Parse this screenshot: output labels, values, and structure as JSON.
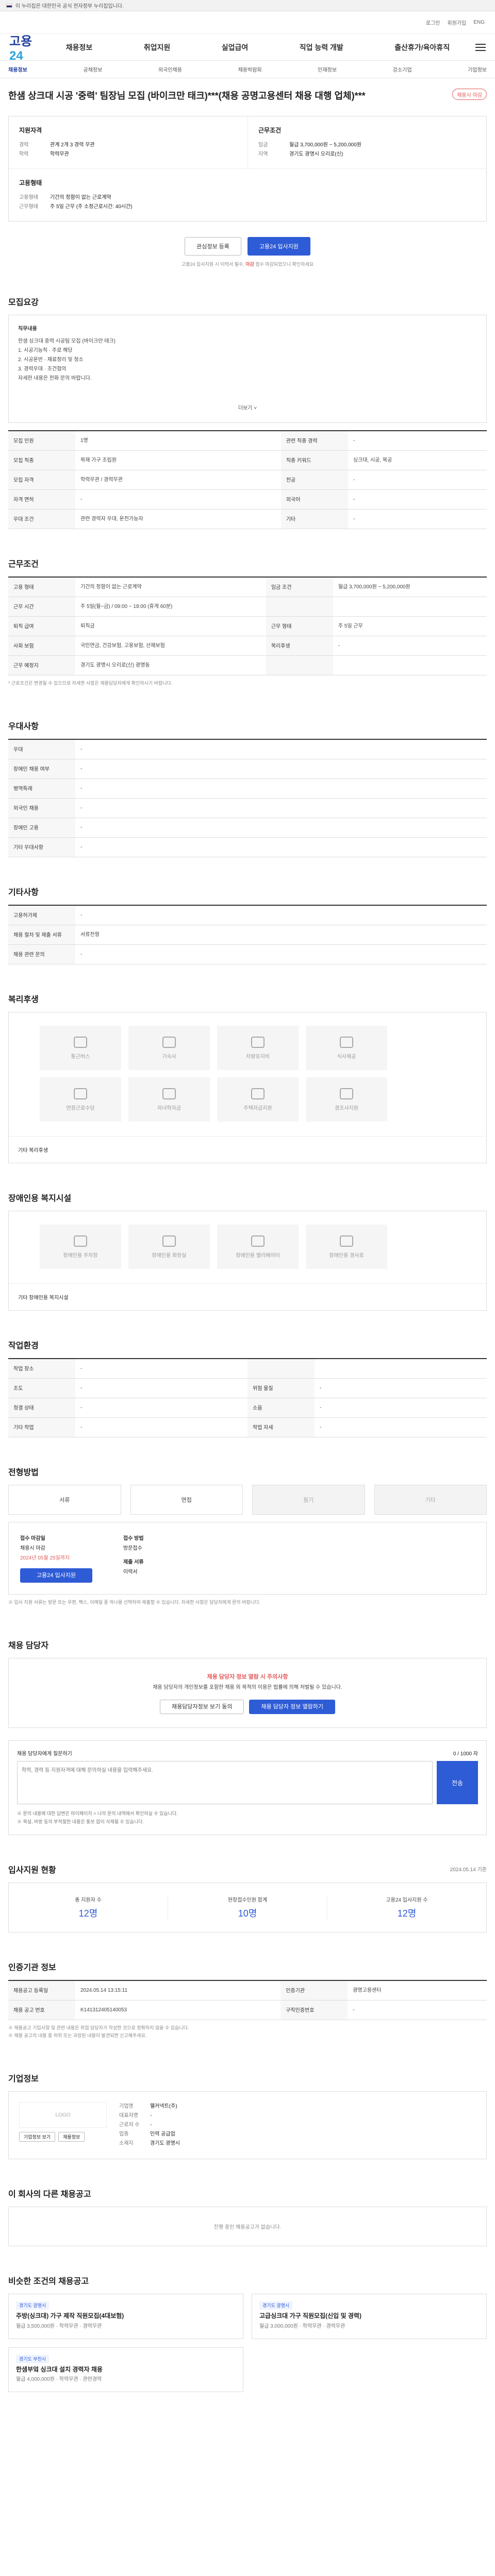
{
  "gov": {
    "text": "이 누리집은 대한민국 공식 전자정부 누리집입니다."
  },
  "util": [
    "로그인",
    "회원가입",
    "ENG"
  ],
  "brand": {
    "logo_a": "고용",
    "logo_b": "24"
  },
  "gnb": [
    "채용정보",
    "취업지원",
    "실업급여",
    "직업 능력 개발",
    "출산휴가/육아휴직"
  ],
  "subnav": {
    "items": [
      "채용정보",
      "공채정보",
      "외국인채용",
      "채용박람회",
      "인재정보",
      "강소기업",
      "기업정보"
    ],
    "active": 0
  },
  "job": {
    "title": "한샘 상크대 시공 '중력' 팀장님 모집 (바이크만 태크)***(채용 공명고용센터 채용 대행 업체)***",
    "badge": "채용시 마감"
  },
  "summary": {
    "qual_title": "지원자격",
    "qual": [
      [
        "경력",
        "관계 2개 3 경력 무관"
      ],
      [
        "학력",
        "학력무관"
      ]
    ],
    "cond_title": "근무조건",
    "cond": [
      [
        "임금",
        "월급 3,700,000원 ~ 5,200,000원"
      ],
      [
        "지역",
        "경기도 광명시 오리로(신)"
      ]
    ],
    "emp_title": "고용형태",
    "emp": [
      [
        "고용형태",
        "기간의 정함이 없는 근로계약"
      ],
      [
        "근무형태",
        "주 5일 근무 (주 소정근로시간: 40시간)"
      ]
    ]
  },
  "actions": {
    "scrap": "관심정보 등록",
    "apply": "고용24 입사지원",
    "note_a": "고용24 입사지원 시 이력서 필수, ",
    "note_red": "마감 ",
    "note_b": "접수 마감되었으니 확인하세요"
  },
  "sections": {
    "recruit": "모집요강",
    "work": "근무조건",
    "welfare": "복리후생",
    "convenience": "장애인용 복지시설",
    "screening": "우대사항",
    "other": "기타사항",
    "env": "작업환경",
    "method": "전형방법",
    "manager": "채용 담당자",
    "stats": "입사지원 현황",
    "info": "인증기관 정보",
    "company": "기업정보",
    "recommend": "이 회사의 다른 채용공고",
    "similar": "비슷한 조건의 채용공고"
  },
  "recruit": {
    "desc_label": "직무내용",
    "desc": "한샘 싱크대 중력 시공팀 모집 (바이크만 태크)\n1. 시공기능직 · 주로 해당\n2. 시공운반 · 재료정리 및 청소\n3. 경력우대 · 조건협의\n자세한 내용은 전화 문의 바랍니다.",
    "more": "더보기 ˅",
    "rows": [
      [
        "모집 인원",
        "1명",
        "관련 직종 경력",
        "-"
      ],
      [
        "모집 직종",
        "목재 가구 조립원",
        "직종 키워드",
        "싱크대, 시공, 목공"
      ],
      [
        "모집 자격",
        "학력무관 / 경력무관",
        "전공",
        "-"
      ],
      [
        "자격 면허",
        "-",
        "외국어",
        "-"
      ],
      [
        "우대 조건",
        "관련 경력자 우대, 운전가능자",
        "기타",
        "-"
      ]
    ]
  },
  "work": {
    "rows": [
      [
        "고용 형태",
        "기간의 정함이 없는 근로계약",
        "임금 조건",
        "월급 3,700,000원 ~ 5,200,000원"
      ],
      [
        "근무 시간",
        "주 5일(월~금) / 09:00 ~ 18:00 (휴게 60분)",
        "",
        ""
      ],
      [
        "퇴직 급여",
        "퇴직금",
        "근무 형태",
        "주 5일 근무"
      ],
      [
        "사회 보험",
        "국민연금, 건강보험, 고용보험, 산재보험",
        "복리후생",
        "-"
      ],
      [
        "근무 예정지",
        "경기도 광명시 오리로(신) 광명동",
        "",
        ""
      ]
    ],
    "foot": "* 근로조건은 변경될 수 있으므로 자세한 사항은 채용담당자에게 확인하시기 바랍니다."
  },
  "welfare_icons": [
    "통근버스",
    "기숙사",
    "차량유지비",
    "식사제공",
    "연장근로수당",
    "자녀학자금",
    "주택자금지원",
    "경조사지원"
  ],
  "welfare_other": "기타 복리후생",
  "convenience_icons": [
    "장애인용 주차장",
    "장애인용 화장실",
    "장애인용 엘리베이터",
    "장애인용 경사로"
  ],
  "convenience_other": "기타 장애인용 복지시설",
  "screening": {
    "rows": [
      [
        "우대",
        "-"
      ],
      [
        "장애인 채용 여부",
        "-"
      ],
      [
        "병역특례",
        "-"
      ],
      [
        "외국인 채용",
        "-"
      ],
      [
        "장애인 고용",
        "-"
      ],
      [
        "기타 우대사항",
        "-"
      ]
    ]
  },
  "other": {
    "rows": [
      [
        "고용허가제",
        "-"
      ],
      [
        "채용 절차 및 제출 서류",
        "서류전형"
      ],
      [
        "채용 관련 문의",
        "-"
      ]
    ]
  },
  "env": {
    "rows": [
      [
        "작업 장소",
        "-",
        "",
        ""
      ],
      [
        "조도",
        "-",
        "위험 물질",
        "-"
      ],
      [
        "청결 상태",
        "-",
        "소음",
        "-"
      ],
      [
        "기타 작업",
        "-",
        "작업 자세",
        "-"
      ]
    ]
  },
  "method": {
    "cards": [
      "서류",
      "면접",
      "필기",
      "기타"
    ],
    "apply_label": "접수 마감일",
    "apply_val": "채용시 마감",
    "apply_red": "2024년 05월 25일까지",
    "apply_btn": "고용24 입사지원",
    "way_label": "접수 방법",
    "way_val": "방문접수",
    "doc_label": "제출 서류",
    "doc_val": "이력서",
    "notes": "※ 입사 지원 서류는 방문 또는 우편, 팩스, 이메일 중 하나를 선택하여 제출할 수 있습니다. 자세한 사항은 담당자에게 문의 바랍니다."
  },
  "manager": {
    "warn_title": "채용 담당자 정보 열람 시 주의사항",
    "warn_text": "채용 담당자의 개인정보를 포함한 채용 외 목적의 이용은 법률에 의해 처벌될 수 있습니다.",
    "btn_a": "채용담당자정보 보기 동의",
    "btn_b": "채용 담당자 정보 열람하기",
    "inq_label": "채용 담당자에게 질문하기",
    "inq_count": "0 / 1000 자",
    "inq_placeholder": "학력, 경력 등 지원자격에 대해 문의하실 내용을 입력해주세요.",
    "inq_send": "전송",
    "inq_notes": "※ 문의 내용에 대한 답변은 마이페이지 > 나의 문의 내역에서 확인하실 수 있습니다.\n※ 욕설, 비방 등의 부적절한 내용은 통보 없이 삭제될 수 있습니다."
  },
  "stats": {
    "items": [
      [
        "총 지원자 수",
        "12명"
      ],
      [
        "현장접수인원 합계",
        "10명"
      ],
      [
        "고용24 입사지원 수",
        "12명"
      ]
    ],
    "date": "2024.05.14 기준"
  },
  "info": {
    "rows": [
      [
        "채용공고 등록일",
        "2024.05.14 13:15:11",
        "인증기관",
        "광명고용센터"
      ],
      [
        "채용 공고 번호",
        "K141312405140053",
        "구직인증번호",
        "-"
      ]
    ],
    "notes": "※ 채용공고 기입사항 및 관련 내용은 취업 담당자가 작성한 것으로 정확하지 않을 수 있습니다.\n※ 채용 공고의 내용 중 허위 또는 과장된 내용이 발견되면 신고해주세요."
  },
  "company": {
    "logo": "LOGO",
    "name_label": "기업명",
    "name": "웰커넥트(주)",
    "rep_label": "대표자명",
    "rep": "-",
    "emp_label": "근로자 수",
    "emp": "-",
    "industry_label": "업종",
    "industry": "인력 공급업",
    "addr_label": "소재지",
    "addr": "경기도 광명시",
    "btn_info": "기업정보 보기",
    "btn_jobs": "채용정보"
  },
  "recommend": {
    "empty": "진행 중인 채용공고가 없습니다."
  },
  "similar": {
    "items": [
      {
        "tag": "경기도 광명시",
        "title": "주방(싱크대) 가구 제작 직원모집(4대보험)",
        "meta": "월급 3,500,000원 · 학력무관 · 경력무관"
      },
      {
        "tag": "경기도 광명시",
        "title": "고급싱크대 가구 직원모집(신입 및 경력)",
        "meta": "월급 3,000,000원 · 학력무관 · 경력무관"
      },
      {
        "tag": "경기도 부천시",
        "title": "한샘부엌 싱크대 설치 경력자 채용",
        "meta": "월급 4,000,000원 · 학력무관 · 관련경력"
      }
    ]
  },
  "colors": {
    "primary": "#2e5bd6",
    "accent": "#e35b5b",
    "brand": "#1f3f9e"
  }
}
